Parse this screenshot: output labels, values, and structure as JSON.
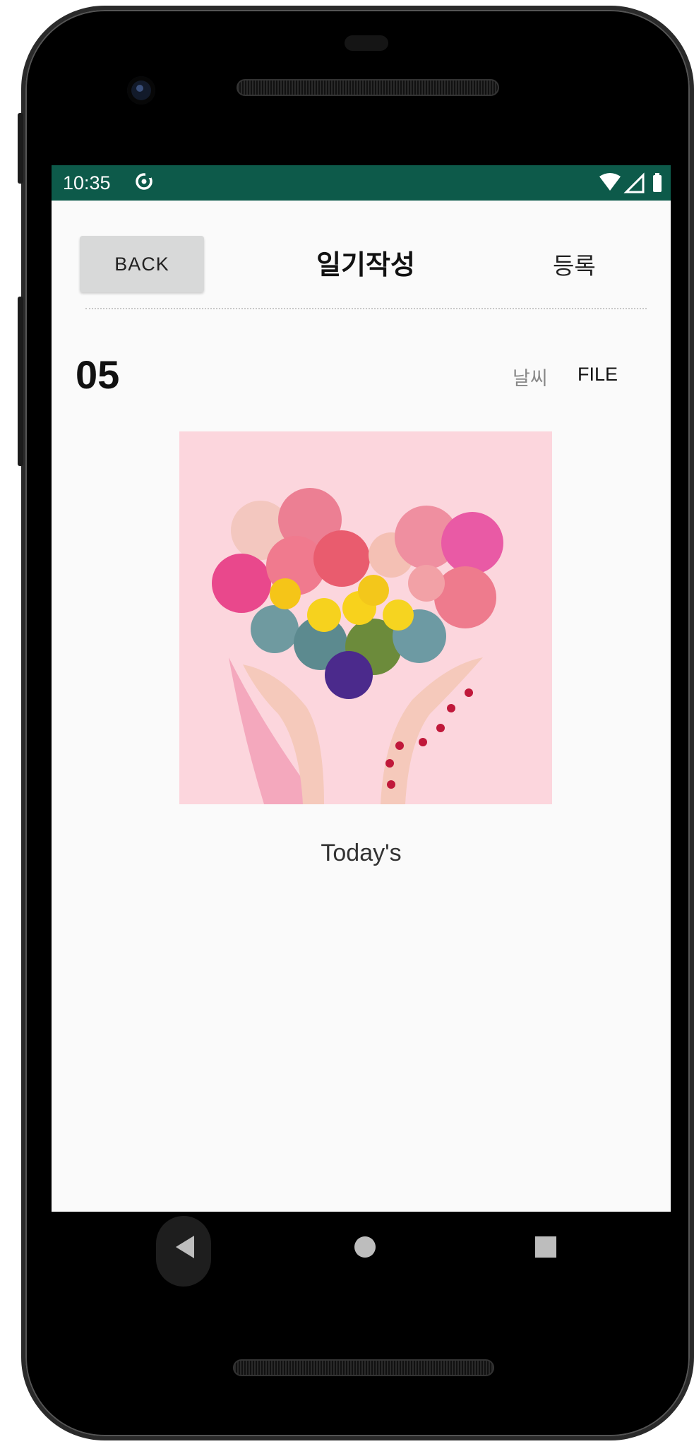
{
  "status_bar": {
    "time": "10:35",
    "background": "#0d5a4a",
    "icons": [
      "sync-icon",
      "wifi-icon",
      "signal-icon",
      "battery-icon"
    ]
  },
  "header": {
    "back_label": "BACK",
    "title": "일기작성",
    "register_label": "등록"
  },
  "entry": {
    "day": "05",
    "weather_label": "날씨",
    "file_label": "FILE",
    "caption": "Today's"
  },
  "nav_bar": {
    "icons": [
      "back-triangle-icon",
      "home-circle-icon",
      "recents-square-icon"
    ]
  },
  "colors": {
    "screen_background": "#fafafa",
    "photo_background": "#fcd6dd",
    "back_button": "#d8d9d9"
  }
}
